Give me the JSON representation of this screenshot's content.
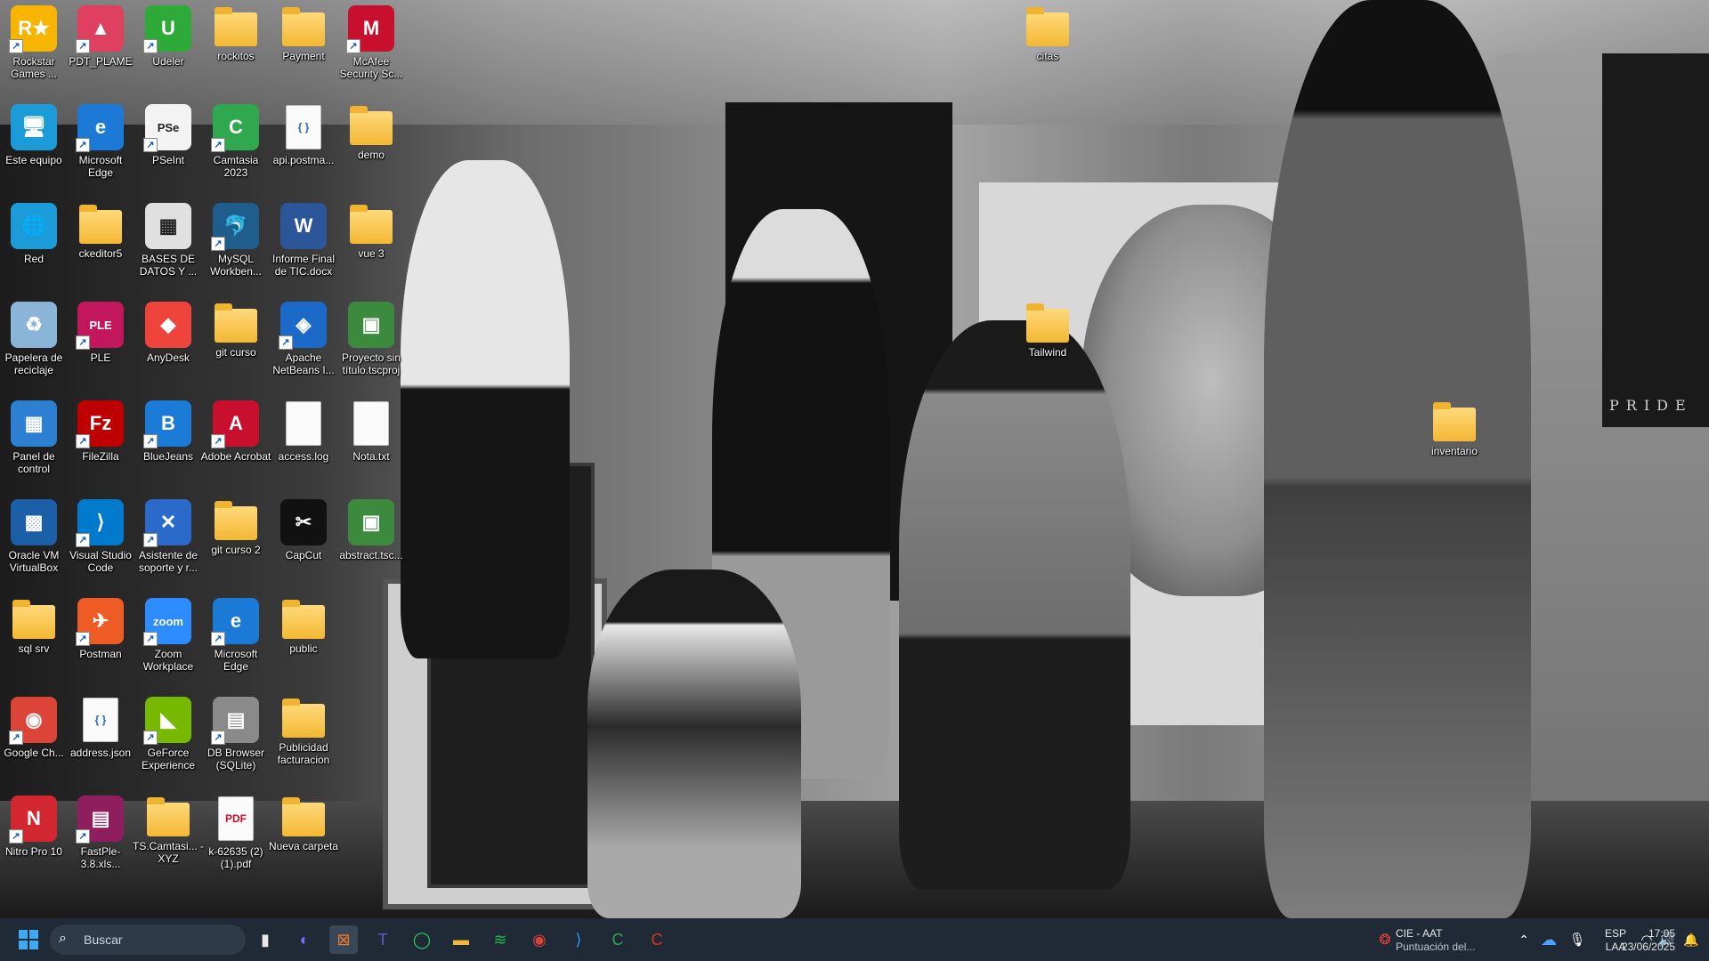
{
  "desktop": {
    "icons": [
      {
        "label": "Rockstar Games ...",
        "glyph": "R★",
        "color": "#f7b500",
        "type": "app",
        "shortcut": true
      },
      {
        "label": "PDT_PLAME",
        "glyph": "▲",
        "color": "#e04060",
        "type": "app",
        "shortcut": true
      },
      {
        "label": "Udeler",
        "glyph": "U",
        "color": "#2eaa39",
        "type": "app",
        "shortcut": true
      },
      {
        "label": "rockitos",
        "type": "folder"
      },
      {
        "label": "Payment",
        "type": "folder"
      },
      {
        "label": "McAfee Security Sc...",
        "glyph": "M",
        "color": "#c8102e",
        "type": "app",
        "shortcut": true
      },
      {
        "label": "Este equipo",
        "glyph": "🖥",
        "color": "#1c9bd9",
        "type": "app"
      },
      {
        "label": "Microsoft Edge",
        "glyph": "e",
        "color": "#1b7ad6",
        "type": "app",
        "shortcut": true
      },
      {
        "label": "PSeInt",
        "glyph": "PSe",
        "color": "#f3f3f3",
        "type": "app",
        "shortcut": true
      },
      {
        "label": "Camtasia 2023",
        "glyph": "C",
        "color": "#2fa84f",
        "type": "app",
        "shortcut": true
      },
      {
        "label": "api.postma...",
        "glyph": "{ }",
        "color": "#f5f5f5",
        "type": "doc"
      },
      {
        "label": "demo",
        "type": "folder"
      },
      {
        "label": "Red",
        "glyph": "🌐",
        "color": "#1c9bd9",
        "type": "app"
      },
      {
        "label": "ckeditor5",
        "type": "folder"
      },
      {
        "label": "BASES DE DATOS Y ...",
        "glyph": "▦",
        "color": "#e0e0e0",
        "type": "app"
      },
      {
        "label": "MySQL Workben...",
        "glyph": "🐬",
        "color": "#1f5d8c",
        "type": "app",
        "shortcut": true
      },
      {
        "label": "Informe Final de TIC.docx",
        "glyph": "W",
        "color": "#2b579a",
        "type": "app"
      },
      {
        "label": "vue 3",
        "type": "folder"
      },
      {
        "label": "Papelera de reciclaje",
        "glyph": "♻",
        "color": "#8ab4d8",
        "type": "app"
      },
      {
        "label": "PLE",
        "glyph": "PLE",
        "color": "#c2185b",
        "type": "app",
        "shortcut": true
      },
      {
        "label": "AnyDesk",
        "glyph": "◆",
        "color": "#ef443b",
        "type": "app"
      },
      {
        "label": "git curso",
        "type": "folder"
      },
      {
        "label": "Apache NetBeans I...",
        "glyph": "◈",
        "color": "#1b6ac9",
        "type": "app",
        "shortcut": true
      },
      {
        "label": "Proyecto sin título.tscproj",
        "glyph": "▣",
        "color": "#3b8a3e",
        "type": "app"
      },
      {
        "label": "Panel de control",
        "glyph": "▦",
        "color": "#2d7fd2",
        "type": "app"
      },
      {
        "label": "FileZilla",
        "glyph": "Fz",
        "color": "#bf0000",
        "type": "app",
        "shortcut": true
      },
      {
        "label": "BlueJeans",
        "glyph": "B",
        "color": "#1d7bd8",
        "type": "app",
        "shortcut": true
      },
      {
        "label": "Adobe Acrobat",
        "glyph": "A",
        "color": "#c8102e",
        "type": "app",
        "shortcut": true
      },
      {
        "label": "access.log",
        "glyph": "",
        "color": "#f5f5f5",
        "type": "doc"
      },
      {
        "label": "Nota.txt",
        "glyph": "",
        "color": "#f5f5f5",
        "type": "doc"
      },
      {
        "label": "Oracle VM VirtualBox",
        "glyph": "▩",
        "color": "#1a5fa8",
        "type": "app"
      },
      {
        "label": "Visual Studio Code",
        "glyph": "⟩",
        "color": "#007acc",
        "type": "app",
        "shortcut": true
      },
      {
        "label": "Asistente de soporte y r...",
        "glyph": "✕",
        "color": "#2a6acb",
        "type": "app",
        "shortcut": true
      },
      {
        "label": "git curso 2",
        "type": "folder"
      },
      {
        "label": "CapCut",
        "glyph": "✂",
        "color": "#111111",
        "type": "app"
      },
      {
        "label": "abstract.tsc...",
        "glyph": "▣",
        "color": "#3b8a3e",
        "type": "app"
      },
      {
        "label": "sql srv",
        "type": "folder"
      },
      {
        "label": "Postman",
        "glyph": "✈",
        "color": "#ef5b25",
        "type": "app",
        "shortcut": true
      },
      {
        "label": "Zoom Workplace",
        "glyph": "zoom",
        "color": "#2d8cff",
        "type": "app",
        "shortcut": true
      },
      {
        "label": "Microsoft Edge",
        "glyph": "e",
        "color": "#1b7ad6",
        "type": "app",
        "shortcut": true
      },
      {
        "label": "public",
        "type": "folder"
      },
      {
        "label": "Google Ch...",
        "glyph": "◉",
        "color": "#db4437",
        "type": "app",
        "shortcut": true
      },
      {
        "label": "address.json",
        "glyph": "{ }",
        "color": "#f5f5f5",
        "type": "doc"
      },
      {
        "label": "GeForce Experience",
        "glyph": "◣",
        "color": "#76b900",
        "type": "app",
        "shortcut": true
      },
      {
        "label": "DB Browser (SQLite)",
        "glyph": "▤",
        "color": "#8a8a8a",
        "type": "app",
        "shortcut": true
      },
      {
        "label": "Publicidad facturacion",
        "type": "folder"
      },
      {
        "label": "Nitro Pro 10",
        "glyph": "N",
        "color": "#d22730",
        "type": "app",
        "shortcut": true
      },
      {
        "label": "FastPle-3.8.xls...",
        "glyph": "▤",
        "color": "#8e1e5e",
        "type": "app",
        "shortcut": true
      },
      {
        "label": "TS.Camtasi... - XYZ",
        "type": "folder"
      },
      {
        "label": "k-62635 (2) (1).pdf",
        "glyph": "PDF",
        "color": "#c8102e",
        "type": "doc"
      },
      {
        "label": "Nueva carpeta",
        "type": "folder"
      },
      {
        "label": "citas",
        "type": "folder"
      },
      {
        "label": "Tailwind",
        "type": "folder"
      },
      {
        "label": "inventario",
        "type": "folder"
      }
    ],
    "wallpaper_text": "PRIDE"
  },
  "taskbar": {
    "start_icon": "windows-start-icon",
    "search_placeholder": "Buscar",
    "pinned": [
      {
        "name": "task-view-icon",
        "glyph": "▮"
      },
      {
        "name": "copilot-icon",
        "glyph": "◐"
      },
      {
        "name": "app-pinned-icon",
        "glyph": "⊠"
      },
      {
        "name": "teams-icon",
        "glyph": "T"
      },
      {
        "name": "whatsapp-icon",
        "glyph": "◯"
      },
      {
        "name": "file-explorer-icon",
        "glyph": "▬"
      },
      {
        "name": "spotify-icon",
        "glyph": "≋"
      },
      {
        "name": "chrome-icon",
        "glyph": "◉"
      },
      {
        "name": "vscode-icon",
        "glyph": "⟩"
      },
      {
        "name": "camtasia-icon",
        "glyph": "C"
      },
      {
        "name": "camtasia-recorder-icon",
        "glyph": "C"
      }
    ],
    "notification": {
      "title": "CIE - AAT",
      "subtitle": "Puntuación del..."
    },
    "language": {
      "top": "ESP",
      "bottom": "LAA"
    },
    "clock": {
      "time": "17:05",
      "date": "23/06/2025"
    }
  },
  "colors": {
    "taskbar": "#1f2a36",
    "folder": "#f3b834",
    "accent": "#0067c0"
  }
}
